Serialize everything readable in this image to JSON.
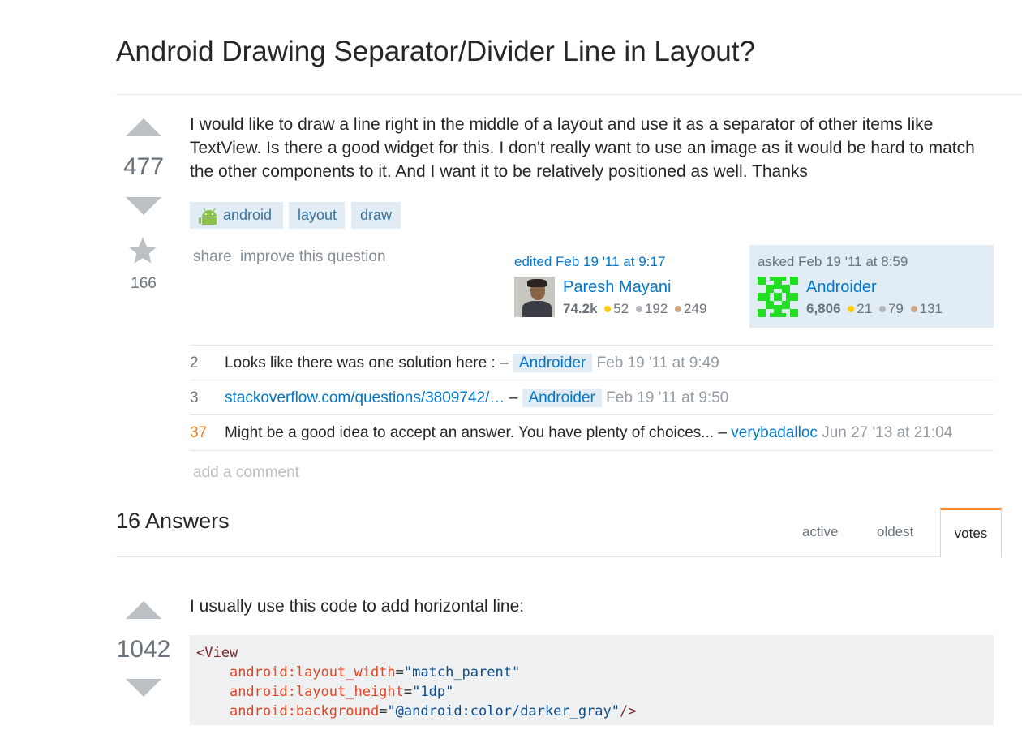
{
  "question": {
    "title": "Android Drawing Separator/Divider Line in Layout?",
    "vote_count": "477",
    "favorite_count": "166",
    "body": "I would like to draw a line right in the middle of a layout and use it as a separator of other items like TextView. Is there a good widget for this. I don't really want to use an image as it would be hard to match the other components to it. And I want it to be relatively positioned as well. Thanks",
    "tags": [
      "android",
      "layout",
      "draw"
    ],
    "menu": {
      "share": "share",
      "improve": "improve this question"
    },
    "editor": {
      "label": "edited Feb 19 '11 at 9:17",
      "name": "Paresh Mayani",
      "reputation": "74.2k",
      "gold": "52",
      "silver": "192",
      "bronze": "249"
    },
    "owner": {
      "label": "asked Feb 19 '11 at 8:59",
      "name": "Androider",
      "reputation": "6,806",
      "gold": "21",
      "silver": "79",
      "bronze": "131"
    },
    "comments": [
      {
        "score": "2",
        "text": "Looks like there was one solution here : –",
        "link": "",
        "user": "Androider",
        "date": "Feb 19 '11 at 9:49"
      },
      {
        "score": "3",
        "text": "",
        "link": "stackoverflow.com/questions/3809742/…",
        "user": "Androider",
        "date": "Feb 19 '11 at 9:50"
      },
      {
        "score": "37",
        "text": "Might be a good idea to accept an answer. You have plenty of choices... –",
        "link": "",
        "user": "verybadalloc",
        "date": "Jun 27 '13 at 21:04"
      }
    ],
    "add_comment": "add a comment",
    "comment_separator": "–"
  },
  "answers_header": {
    "count_label": "16 Answers",
    "tabs": [
      "active",
      "oldest",
      "votes"
    ],
    "active_tab": "votes"
  },
  "answer": {
    "vote_count": "1042",
    "body": "I usually use this code to add horizontal line:",
    "code": {
      "open": "<View",
      "attrs": [
        {
          "name": "android:layout_width",
          "value": "\"match_parent\""
        },
        {
          "name": "android:layout_height",
          "value": "\"1dp\""
        },
        {
          "name": "android:background",
          "value": "\"@android:color/darker_gray\""
        }
      ],
      "close": "/>"
    }
  },
  "colors": {
    "link": "#0077cc",
    "tag_bg": "#e1ecf4",
    "tag_fg": "#39739d",
    "accent": "#f48024",
    "vote_arrow": "#bbc0c4"
  },
  "icons": {
    "vote_up": "triangle-up-icon",
    "vote_down": "triangle-down-icon",
    "favorite": "star-icon",
    "tag_android": "android-robot-icon"
  }
}
